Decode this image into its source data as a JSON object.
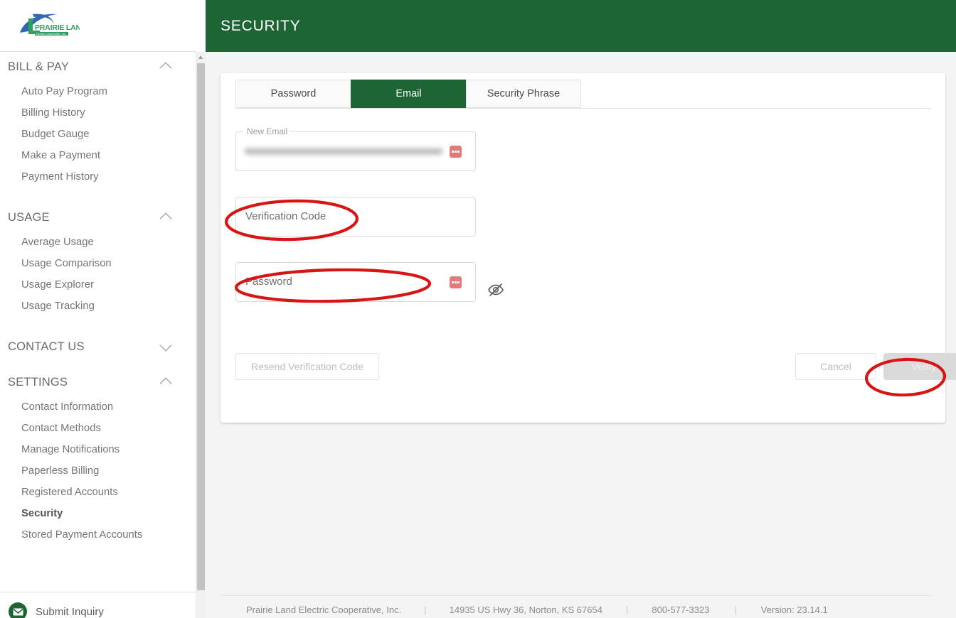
{
  "brand": {
    "logo_name_line1": "PRAIRIE LAND",
    "logo_name_line2": "Electric Cooperative, Inc.",
    "green": "#1d6634",
    "blue": "#2e68b0"
  },
  "header": {
    "title": "SECURITY"
  },
  "sidebar": {
    "groups": [
      {
        "label": "BILL & PAY",
        "expanded": true,
        "chevron": "chevron-up-icon",
        "items": [
          {
            "label": "Auto Pay Program",
            "active": false
          },
          {
            "label": "Billing History",
            "active": false
          },
          {
            "label": "Budget Gauge",
            "active": false
          },
          {
            "label": "Make a Payment",
            "active": false
          },
          {
            "label": "Payment History",
            "active": false
          }
        ]
      },
      {
        "label": "USAGE",
        "expanded": true,
        "chevron": "chevron-up-icon",
        "items": [
          {
            "label": "Average Usage",
            "active": false
          },
          {
            "label": "Usage Comparison",
            "active": false
          },
          {
            "label": "Usage Explorer",
            "active": false
          },
          {
            "label": "Usage Tracking",
            "active": false
          }
        ]
      },
      {
        "label": "CONTACT US",
        "expanded": false,
        "chevron": "chevron-down-icon",
        "items": []
      },
      {
        "label": "SETTINGS",
        "expanded": true,
        "chevron": "chevron-up-icon",
        "items": [
          {
            "label": "Contact Information",
            "active": false
          },
          {
            "label": "Contact Methods",
            "active": false
          },
          {
            "label": "Manage Notifications",
            "active": false
          },
          {
            "label": "Paperless Billing",
            "active": false
          },
          {
            "label": "Registered Accounts",
            "active": false
          },
          {
            "label": "Security",
            "active": true
          },
          {
            "label": "Stored Payment Accounts",
            "active": false
          }
        ]
      }
    ],
    "footer": {
      "inquiry_label": "Submit Inquiry",
      "inquiry_icon": "envelope-icon"
    }
  },
  "main": {
    "tabs": [
      {
        "label": "Password",
        "active": false
      },
      {
        "label": "Email",
        "active": true
      },
      {
        "label": "Security Phrase",
        "active": false
      }
    ],
    "fields": {
      "new_email": {
        "legend": "New Email",
        "value_redacted": true,
        "badge_icon": "password-manager-icon"
      },
      "verification_code": {
        "placeholder": "Verification Code",
        "value": ""
      },
      "password": {
        "placeholder": "Password",
        "value": "",
        "badge_icon": "password-manager-icon",
        "toggle_icon": "eye-off-icon"
      }
    },
    "buttons": {
      "resend": {
        "label": "Resend Verification Code",
        "disabled": true
      },
      "cancel": {
        "label": "Cancel",
        "disabled": true
      },
      "verify": {
        "label": "Verify",
        "disabled": true
      }
    }
  },
  "footer": {
    "company": "Prairie Land Electric Cooperative, Inc.",
    "address": "14935 US Hwy 36, Norton, KS 67654",
    "phone": "800-577-3323",
    "version": "Version: 23.14.1",
    "separator": "|"
  },
  "annotations": {
    "color": "#d81515",
    "shapes": [
      {
        "target": "verification-code-field"
      },
      {
        "target": "password-field"
      },
      {
        "target": "verify-button"
      }
    ]
  }
}
